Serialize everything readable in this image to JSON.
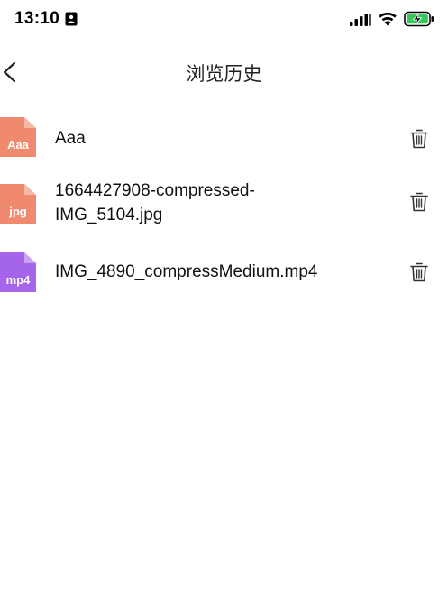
{
  "status_bar": {
    "time": "13:10",
    "id_icon": "contact-card-icon",
    "signal_icon": "cellular-signal-icon",
    "wifi_icon": "wifi-icon",
    "battery_icon": "battery-charging-icon",
    "battery_color": "#34c759"
  },
  "nav": {
    "back_icon": "chevron-left-icon",
    "title": "浏览历史"
  },
  "history": {
    "items": [
      {
        "ext": "Aaa",
        "name": "Aaa",
        "icon_color": "#f08a6e",
        "delete_icon": "trash-icon"
      },
      {
        "ext": "jpg",
        "name": "1664427908-compressed-\nIMG_5104.jpg",
        "icon_color": "#f08a6e",
        "delete_icon": "trash-icon"
      },
      {
        "ext": "mp4",
        "name": "IMG_4890_compressMedium.mp4",
        "icon_color": "#a565ea",
        "delete_icon": "trash-icon"
      }
    ]
  }
}
